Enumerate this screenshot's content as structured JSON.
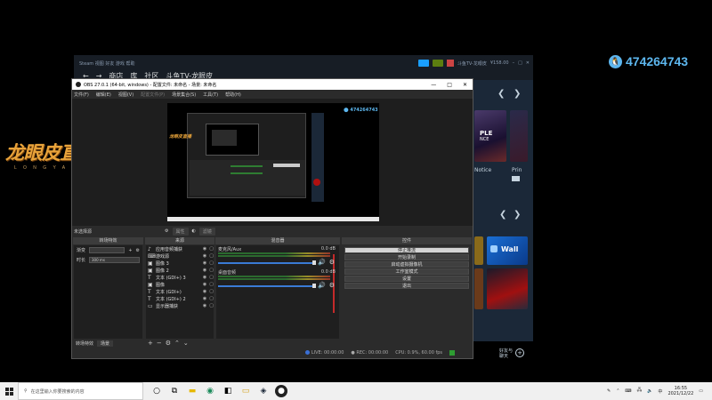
{
  "overlay": {
    "logo_cn": "龙眼皮直播",
    "logo_en": "L O N G Y A N P I",
    "qq_number": "474264743",
    "qq_icon": "qq-icon"
  },
  "steam": {
    "title_left": "Steam  视图  好友  游戏  帮助",
    "nav": [
      "商店",
      "库",
      "社区",
      "斗鱼TV-龙眼皮"
    ],
    "user": "斗鱼TV-龙眼皮",
    "balance": "¥158.00",
    "card_text_1": "PLE",
    "card_text_2": "NCE",
    "card_label_notice": "Notice",
    "card_label_prin": "Prin",
    "wallpaper_text": "Wall",
    "friend_label": "好友与\n聊天"
  },
  "obs": {
    "title": "OBS 27.0.1 (64-bit, windows) - 配置文件: 未命名 - 场景: 未命名",
    "menu": [
      "文件(F)",
      "编辑(E)",
      "视图(V)",
      "配置文件(P)",
      "场景集合(S)",
      "工具(T)",
      "帮助(H)"
    ],
    "no_source_selected": "未选择源",
    "properties_btn": "属性",
    "filters_btn": "滤镜",
    "scene_filter_header": "转场特效",
    "sources_header": "来源",
    "mixer_header": "混音器",
    "controls_header": "控件",
    "fade_label": "渐变",
    "duration_label": "时长",
    "duration_value": "300 ms",
    "scene_tab_1": "转场特效",
    "scene_tab_2": "场景",
    "sources": [
      {
        "icon": "speaker-icon",
        "name": "应用音频捕获"
      },
      {
        "icon": "gamepad-icon",
        "name": "游戏源"
      },
      {
        "icon": "image-icon",
        "name": "图像 3"
      },
      {
        "icon": "image-icon",
        "name": "图像 2"
      },
      {
        "icon": "text-icon",
        "name": "文本 (GDI+) 3"
      },
      {
        "icon": "image-icon",
        "name": "图像"
      },
      {
        "icon": "text-icon",
        "name": "文本 (GDI+)"
      },
      {
        "icon": "text-icon",
        "name": "文本 (GDI+) 2"
      },
      {
        "icon": "monitor-icon",
        "name": "显示器捕获"
      }
    ],
    "mixer": [
      {
        "name": "麦克风/Aux",
        "db": "0.0 dB"
      },
      {
        "name": "桌面音频",
        "db": "0.0 dB"
      }
    ],
    "controls": [
      "停止推流",
      "开始录制",
      "启动虚拟摄像机",
      "工作室模式",
      "设置",
      "退出"
    ],
    "status": {
      "live": "LIVE: 00:00:00",
      "rec": "REC: 00:00:00",
      "cpu": "CPU: 0.9%, 60.00 fps"
    }
  },
  "taskbar": {
    "search_placeholder": "在这里输入你要搜索的内容",
    "time": "16:55",
    "date": "2021/12/22"
  },
  "colors": {
    "obs_bg": "#2b2b2b",
    "steam_bg": "#1b2838",
    "accent_blue": "#5db7ef",
    "logo_gold": "#e8a33a"
  }
}
